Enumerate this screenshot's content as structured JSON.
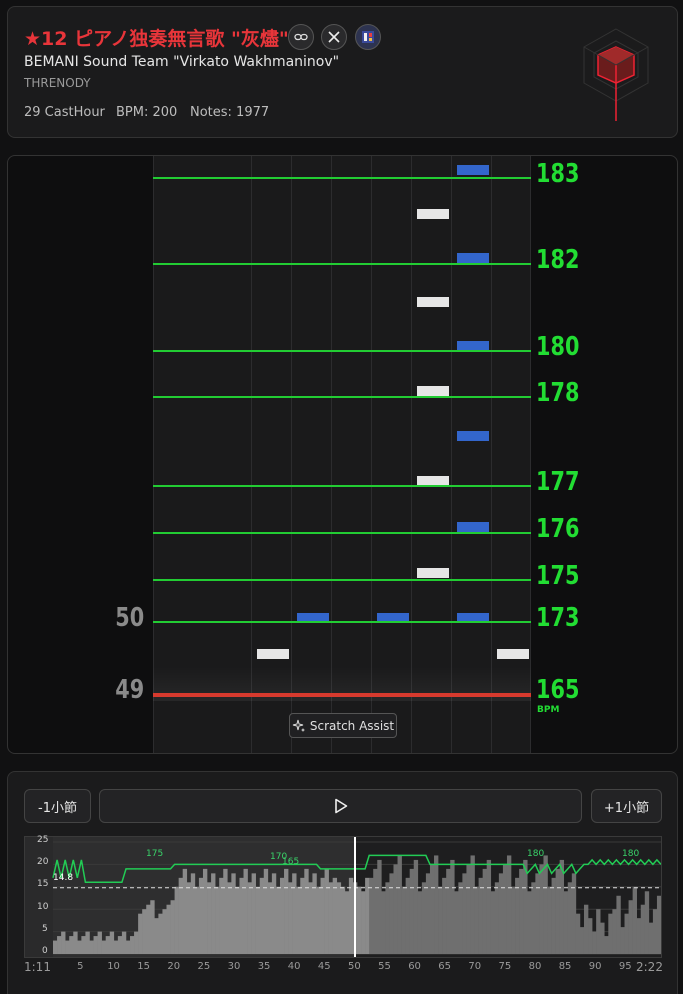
{
  "header": {
    "title": "★12 ピアノ独奏無言歌 \"灰燼\"",
    "artist": "BEMANI Sound Team \"Virkato Wakhmaninov\"",
    "genre": "THRENODY",
    "cast_hour": "29 CastHour",
    "bpm": "BPM: 200",
    "notes": "Notes: 1977",
    "share_icons": [
      "link-icon",
      "x-logo-icon",
      "app-icon"
    ]
  },
  "chart_view": {
    "bpm_labels": [
      "183",
      "182",
      "180",
      "178",
      "177",
      "176",
      "175",
      "173",
      "165"
    ],
    "bpm_unit": "BPM",
    "measures": [
      "50",
      "49"
    ],
    "scratch_assist": "Scratch Assist",
    "colors": {
      "bpm_line": "#22cc33",
      "judge_line": "#d73a2e",
      "white_note": "#e6e6e6",
      "blue_note": "#3366cc"
    }
  },
  "player": {
    "prev_label": "-1小節",
    "next_label": "+1小節",
    "play_icon": "play-icon",
    "time_start": "1:11",
    "time_end": "2:22",
    "y_ticks": [
      "25",
      "20",
      "15",
      "10",
      "5",
      "0"
    ],
    "x_ticks": [
      "5",
      "10",
      "15",
      "20",
      "25",
      "30",
      "35",
      "40",
      "45",
      "50",
      "55",
      "60",
      "65",
      "70",
      "75",
      "80",
      "85",
      "90",
      "95"
    ],
    "graph_labels": [
      "14.8",
      "175",
      "170",
      "165",
      "180",
      "180"
    ]
  }
}
